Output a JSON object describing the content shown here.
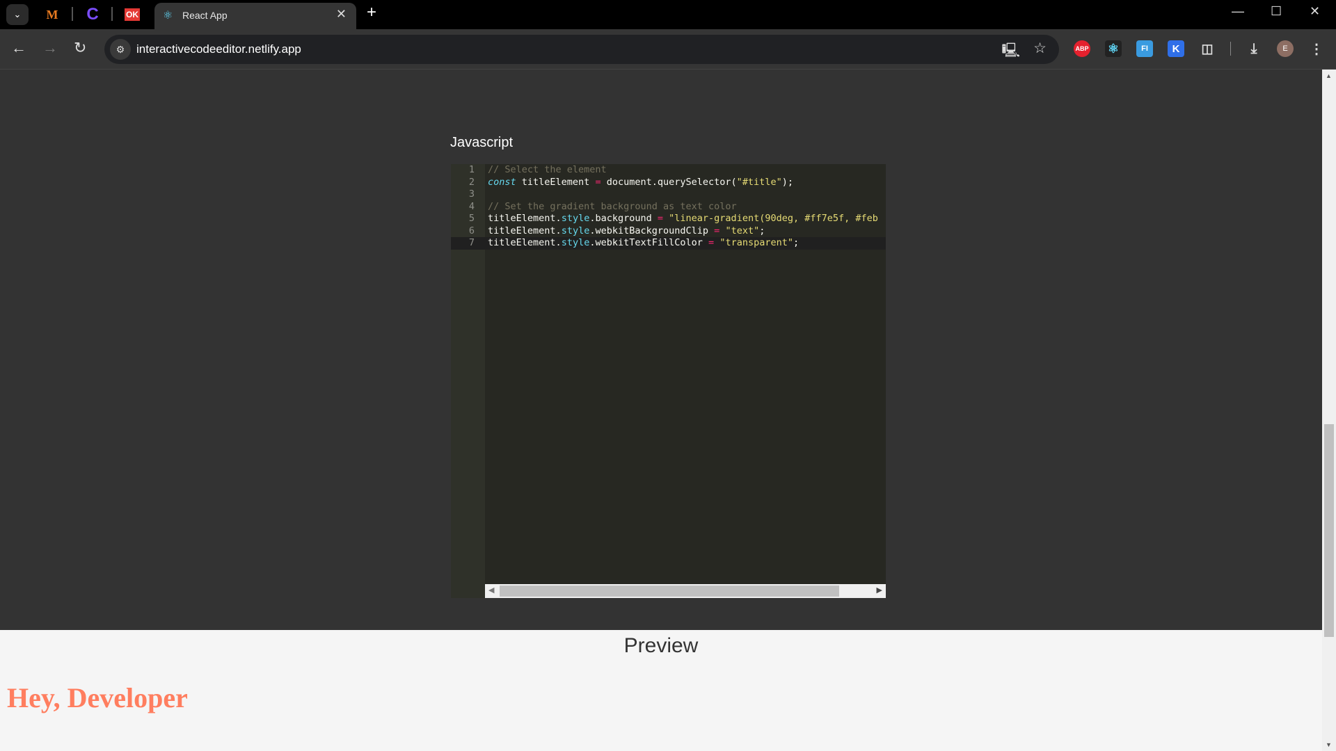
{
  "browser": {
    "tabs": [
      {
        "label": "React App",
        "active": true
      }
    ],
    "pinned_tabs": [
      "M",
      "C",
      "OK"
    ],
    "url": "interactivecodeeditor.netlify.app",
    "extensions": [
      "ABP",
      "React DevTools",
      "FI",
      "K",
      "Extensions"
    ],
    "profile_initial": "E"
  },
  "editor": {
    "title": "Javascript",
    "language": "javascript",
    "active_line": 7,
    "lines": [
      "// Select the element",
      "const titleElement = document.querySelector(\"#title\");",
      "",
      "// Set the gradient background as text color",
      "titleElement.style.background = \"linear-gradient(90deg, #ff7e5f, #feb",
      "titleElement.style.webkitBackgroundClip = \"text\";",
      "titleElement.style.webkitTextFillColor = \"transparent\";"
    ]
  },
  "preview": {
    "heading": "Preview",
    "title_text": "Hey, Developer",
    "title_color": "#ff7e5f"
  }
}
